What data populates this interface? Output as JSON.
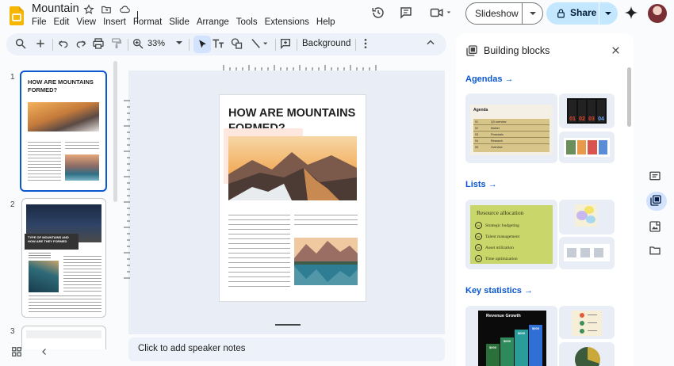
{
  "document": {
    "title": "Mountain"
  },
  "menu": [
    "File",
    "Edit",
    "View",
    "Insert",
    "Format",
    "Slide",
    "Arrange",
    "Tools",
    "Extensions",
    "Help"
  ],
  "header": {
    "slideshow_label": "Slideshow",
    "share_label": "Share"
  },
  "toolbar": {
    "zoom": "33%",
    "background_label": "Background"
  },
  "filmstrip": {
    "slides": [
      {
        "number": "1",
        "heading": "HOW ARE MOUNTAINS FORMED?"
      },
      {
        "number": "2",
        "heading": "TYPE OF MOUNTAINS AND HOW ARE THEY FORMED"
      },
      {
        "number": "3"
      }
    ]
  },
  "slide": {
    "heading": "HOW ARE MOUNTAINS FORMED?"
  },
  "speaker_notes": {
    "placeholder": "Click to add speaker notes"
  },
  "panel": {
    "title": "Building blocks",
    "sections": [
      {
        "title": "Agendas",
        "arrow": "→"
      },
      {
        "title": "Lists",
        "arrow": "→"
      },
      {
        "title": "Key statistics",
        "arrow": "→"
      }
    ],
    "agenda_preview": {
      "title": "Agenda",
      "rows": [
        {
          "num": "01",
          "text": "Q3 overview"
        },
        {
          "num": "02",
          "text": "Market"
        },
        {
          "num": "03",
          "text": "Financials"
        },
        {
          "num": "04",
          "text": "Research"
        },
        {
          "num": "05",
          "text": "Overview"
        }
      ]
    },
    "dark_agenda_numbers": [
      "01",
      "02",
      "03",
      "04"
    ],
    "list_preview": {
      "title": "Resource allocation",
      "items": [
        {
          "num": "01",
          "text": "Strategic budgeting"
        },
        {
          "num": "02",
          "text": "Talent management"
        },
        {
          "num": "03",
          "text": "Asset utilization"
        },
        {
          "num": "04",
          "text": "Time optimization"
        }
      ]
    },
    "stats_preview": {
      "title": "Revenue Growth",
      "values": [
        "$000",
        "$000",
        "$000",
        "$000"
      ]
    }
  }
}
